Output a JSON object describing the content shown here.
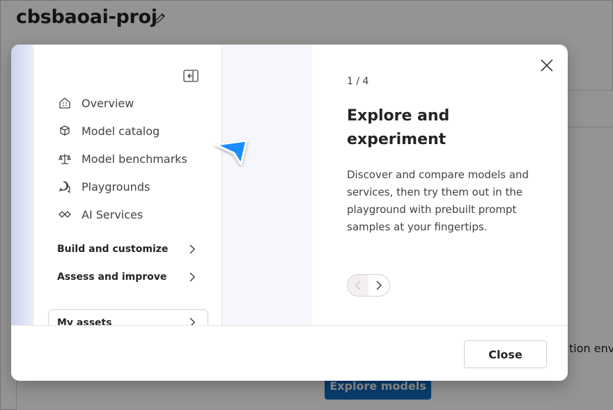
{
  "background": {
    "project_title": "cbsbaoai-proj",
    "partial_text": "tion envi",
    "explore_button": "Explore models"
  },
  "nav": {
    "items": [
      {
        "label": "Overview",
        "icon": "home-grid-icon"
      },
      {
        "label": "Model catalog",
        "icon": "cube-icon"
      },
      {
        "label": "Model benchmarks",
        "icon": "scale-icon"
      },
      {
        "label": "Playgrounds",
        "icon": "chat-bubbles-icon"
      },
      {
        "label": "AI Services",
        "icon": "diamond-link-icon"
      }
    ],
    "groups": [
      {
        "label": "Build and customize"
      },
      {
        "label": "Assess and improve"
      }
    ],
    "assets_label": "My assets"
  },
  "tour": {
    "step": "1 / 4",
    "heading": "Explore and experiment",
    "description": "Discover and compare models and services, then try them out in the playground with prebuilt prompt samples at your fingertips."
  },
  "footer": {
    "close_label": "Close"
  },
  "colors": {
    "accent": "#0f6cbd",
    "pointer": "#1a8cff"
  }
}
